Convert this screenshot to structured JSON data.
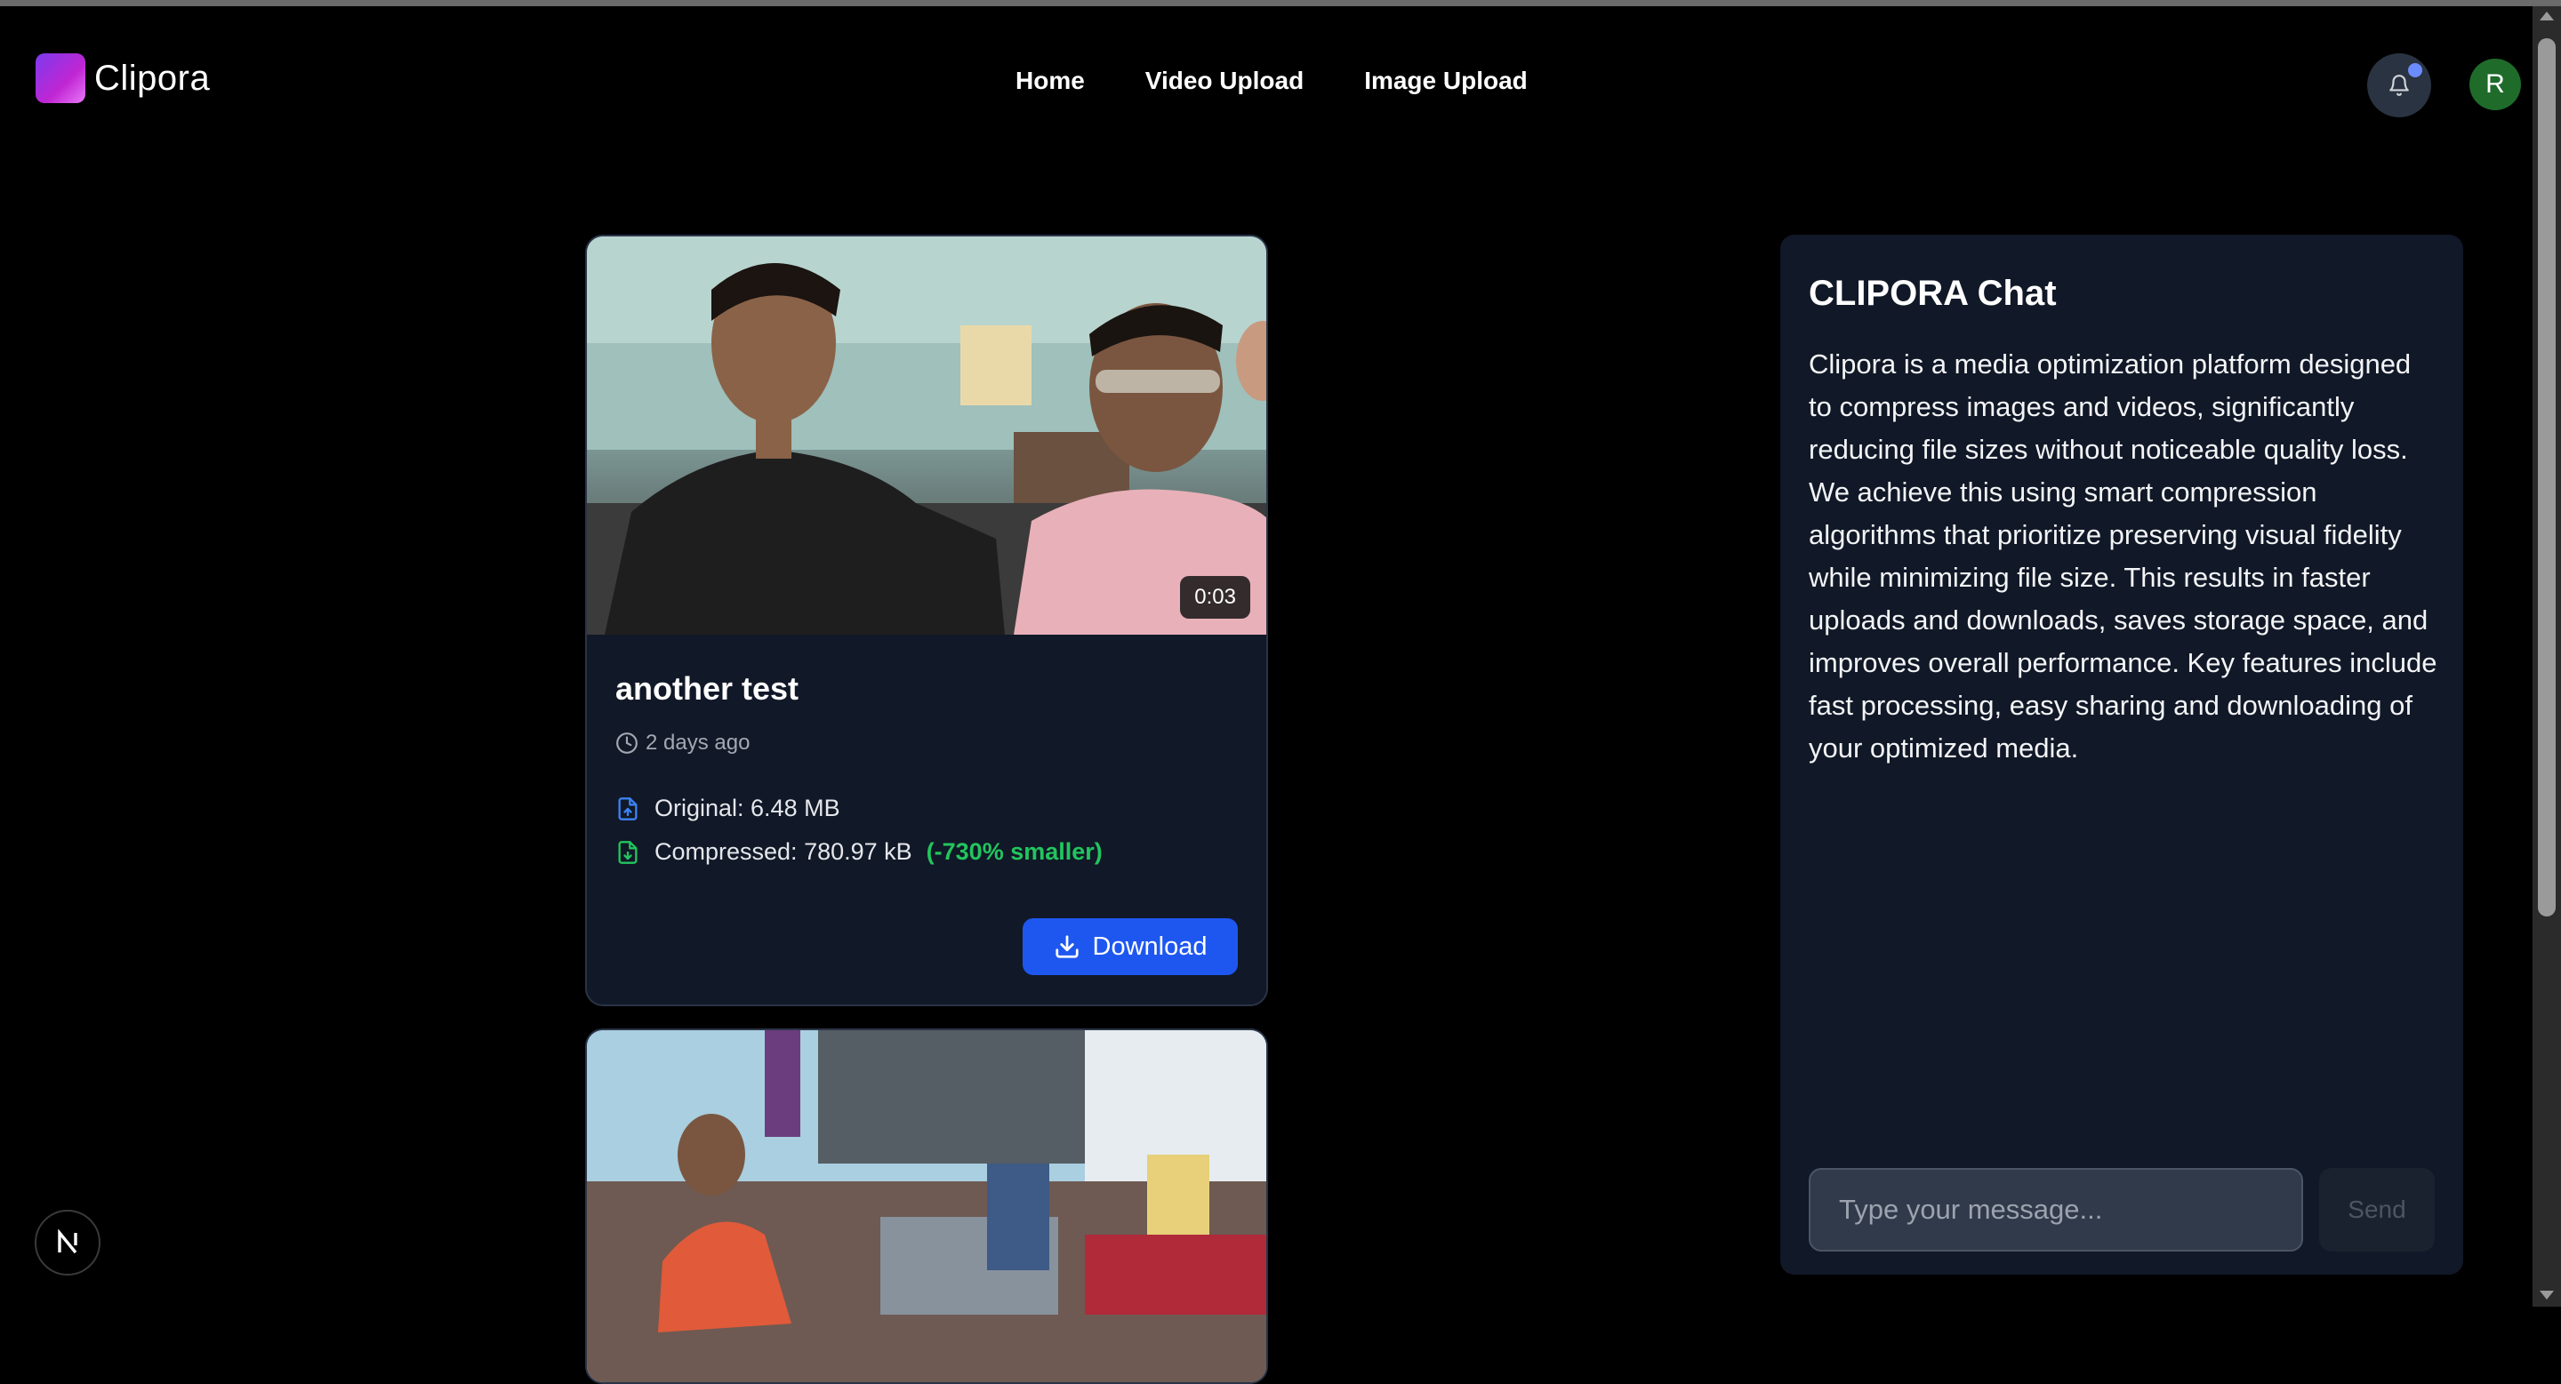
{
  "brand": {
    "name": "Clipora"
  },
  "nav": {
    "links": [
      "Home",
      "Video Upload",
      "Image Upload"
    ]
  },
  "user": {
    "avatar_initial": "R",
    "notification_icon": "bell-icon"
  },
  "videos": [
    {
      "title": "another test",
      "duration": "0:03",
      "uploaded": "2 days ago",
      "original": "Original: 6.48 MB",
      "compressed": "Compressed: 780.97 kB",
      "savings": "(-730% smaller)",
      "download_label": "Download"
    },
    {
      "title": "",
      "duration": ""
    }
  ],
  "chat": {
    "title": "CLIPORA Chat",
    "message": "Clipora is a media optimization platform designed to compress images and videos, significantly reducing file sizes without noticeable quality loss. We achieve this using smart compression algorithms that prioritize preserving visual fidelity while minimizing file size. This results in faster uploads and downloads, saves storage space, and improves overall performance. Key features include fast processing, easy sharing and downloading of your optimized media.",
    "input_placeholder": "Type your message...",
    "send_label": "Send"
  },
  "dev_indicator": {
    "label": "N"
  },
  "colors": {
    "background": "#000000",
    "card": "#111827",
    "accent_blue": "#1e57f0",
    "savings_green": "#22c55e",
    "avatar_green": "#1f6b2a"
  }
}
